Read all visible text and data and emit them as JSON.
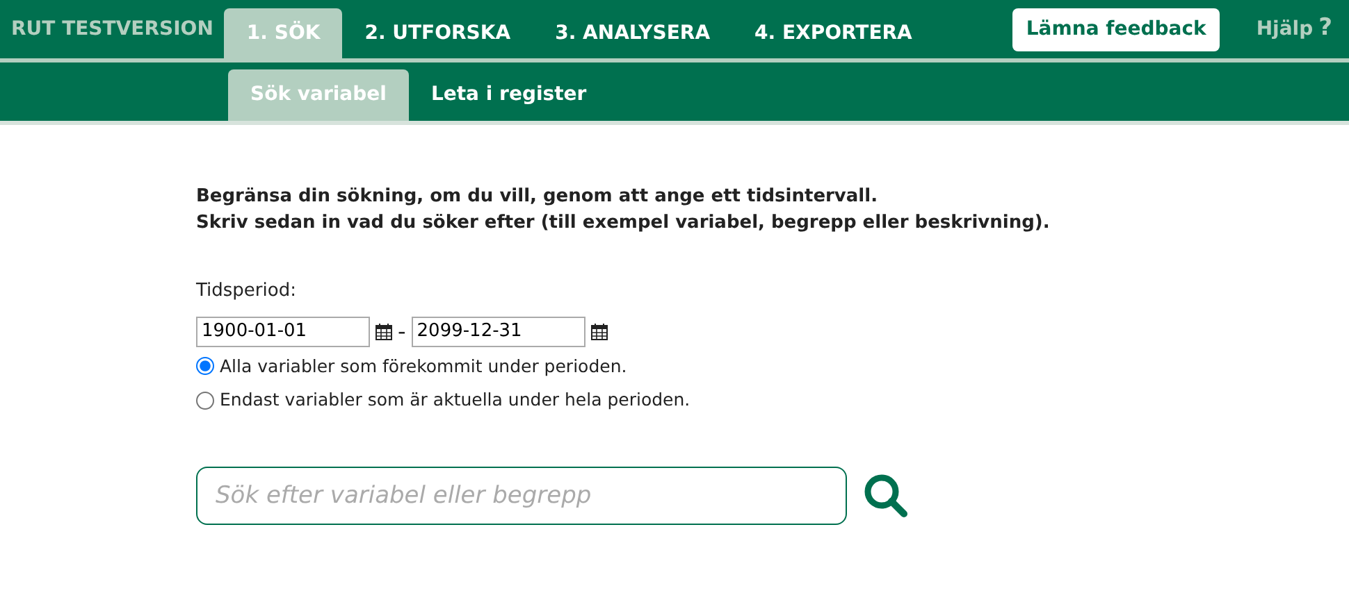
{
  "brand": "RUT TESTVERSION",
  "tabs": [
    {
      "label": "1. SÖK",
      "selected": true
    },
    {
      "label": "2. UTFORSKA",
      "selected": false
    },
    {
      "label": "3. ANALYSERA",
      "selected": false
    },
    {
      "label": "4. EXPORTERA",
      "selected": false
    }
  ],
  "feedback_button": "Lämna feedback",
  "help": {
    "label": "Hjälp",
    "icon": "?"
  },
  "subtabs": [
    {
      "label": "Sök variabel",
      "selected": true
    },
    {
      "label": "Leta i register",
      "selected": false
    }
  ],
  "intro": [
    "Begränsa din sökning, om du vill, genom att ange ett tidsintervall.",
    "Skriv sedan in vad du söker efter (till exempel variabel, begrepp eller beskrivning)."
  ],
  "period": {
    "label": "Tidsperiod:",
    "from": "1900-01-01",
    "separator": "-",
    "to": "2099-12-31"
  },
  "options": [
    {
      "label": "Alla variabler som förekommit under perioden.",
      "selected": true
    },
    {
      "label": "Endast variabler som är aktuella under hela perioden.",
      "selected": false
    }
  ],
  "search": {
    "placeholder": "Sök efter variabel eller begrepp"
  }
}
